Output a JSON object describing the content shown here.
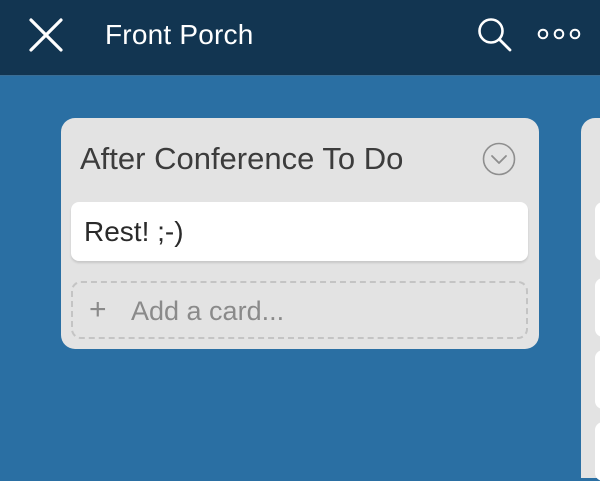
{
  "header": {
    "board_title": "Front Porch",
    "icons": {
      "close": "close-icon",
      "search": "search-icon",
      "more": "more-icon"
    }
  },
  "list": {
    "title": "After Conference To Do",
    "menu_icon": "chevron-down-icon",
    "cards": [
      {
        "text": "Rest! ;-)"
      }
    ],
    "add_card": {
      "plus": "+",
      "label": "Add a card..."
    }
  },
  "colors": {
    "header_bg": "#123551",
    "board_bg": "#2a6fa3",
    "list_bg": "#e3e3e3",
    "card_bg": "#ffffff"
  }
}
